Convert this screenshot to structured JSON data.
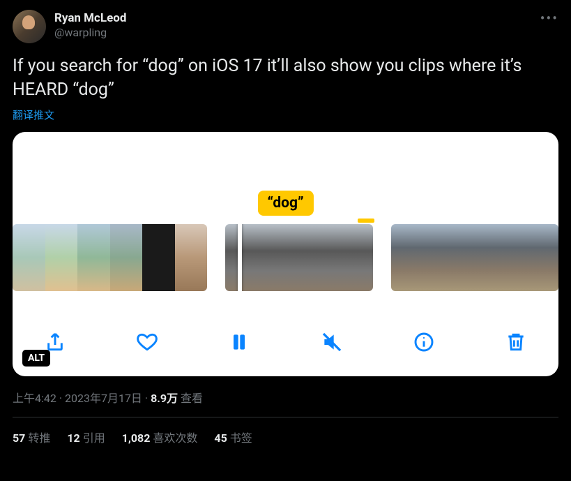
{
  "author": {
    "display_name": "Ryan McLeod",
    "handle": "@warpling"
  },
  "tweet_text": "If you search for “dog” on iOS 17 it’ll also show you clips where it’s HEARD “dog”",
  "translate_label": "翻译推文",
  "media": {
    "caption_bubble": "“dog”",
    "alt_badge": "ALT",
    "toolbar": {
      "share": "share",
      "like": "like",
      "pause": "pause",
      "mute": "mute",
      "info": "info",
      "trash": "trash"
    }
  },
  "meta": {
    "time": "上午4:42",
    "dot1": " · ",
    "date": "2023年7月17日",
    "dot2": " · ",
    "views_count": "8.9万",
    "views_label": " 查看"
  },
  "stats": {
    "retweets_count": "57",
    "retweets_label": "转推",
    "quotes_count": "12",
    "quotes_label": "引用",
    "likes_count": "1,082",
    "likes_label": "喜欢次数",
    "bookmarks_count": "45",
    "bookmarks_label": "书签"
  }
}
